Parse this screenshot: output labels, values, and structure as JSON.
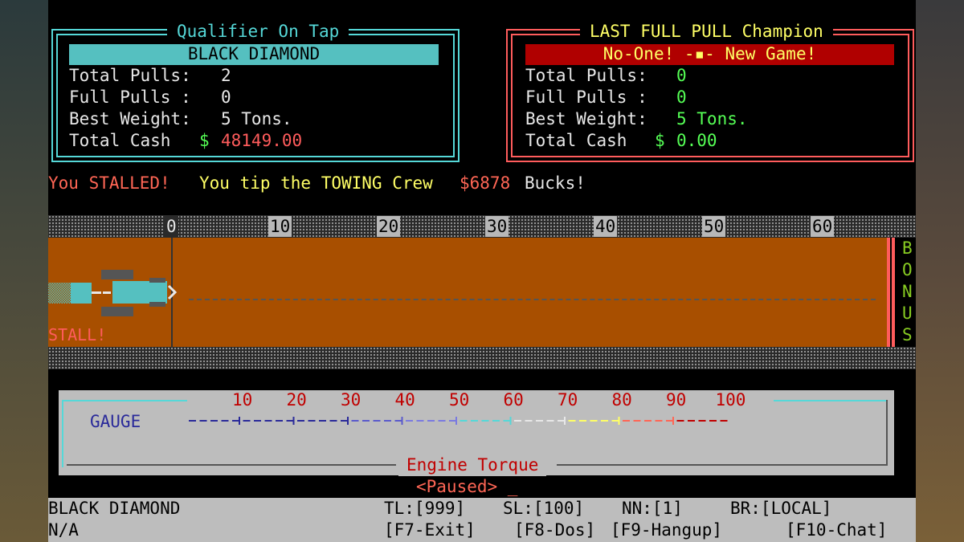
{
  "qualifier": {
    "title": "Qualifier On Tap",
    "name": "BLACK DIAMOND",
    "total_pulls_label": "Total Pulls:",
    "total_pulls": "2",
    "full_pulls_label": "Full Pulls :",
    "full_pulls": "0",
    "best_weight_label": "Best Weight:",
    "best_weight": "5 Tons.",
    "total_cash_label": "Total Cash",
    "cash_symbol": "$",
    "total_cash": "48149.00"
  },
  "champion": {
    "title": "LAST FULL PULL Champion",
    "name": "No-One! -▪- New Game!",
    "total_pulls_label": "Total Pulls:",
    "total_pulls": "0",
    "full_pulls_label": "Full Pulls :",
    "full_pulls": "0",
    "best_weight_label": "Best Weight:",
    "best_weight": "5 Tons.",
    "total_cash_label": "Total Cash",
    "cash_symbol": "$",
    "total_cash": "0.00"
  },
  "message": {
    "stalled": "You STALLED!",
    "tip_prefix": "You tip the TOWING Crew",
    "tip_amount": "$6878",
    "tip_suffix": "Bucks!"
  },
  "track": {
    "markers": [
      "0",
      "10",
      "20",
      "30",
      "40",
      "50",
      "60"
    ],
    "stall_label": "STALL!",
    "bonus_letters": [
      "B",
      "O",
      "N",
      "U",
      "S"
    ],
    "tractor_position": 0
  },
  "gauge": {
    "label": "GAUGE",
    "scale": [
      "10",
      "20",
      "30",
      "40",
      "50",
      "60",
      "70",
      "80",
      "90",
      "100"
    ],
    "caption": "Engine Torque",
    "value": 0
  },
  "paused": "<Paused> _",
  "status_bar": {
    "user": "BLACK DIAMOND",
    "location": "N/A",
    "tl": "TL:[999]",
    "sl": "SL:[100]",
    "nn": "NN:[1]",
    "br": "BR:[LOCAL]",
    "f7": "[F7-Exit]",
    "f8": "[F8-Dos]",
    "f9": "[F9-Hangup]",
    "f10": "[F10-Chat]"
  },
  "colors": {
    "cyan": "#55d8d8",
    "red": "#ff5c5c",
    "dirt": "#a84f00",
    "panel_gray": "#bdbdbd"
  }
}
